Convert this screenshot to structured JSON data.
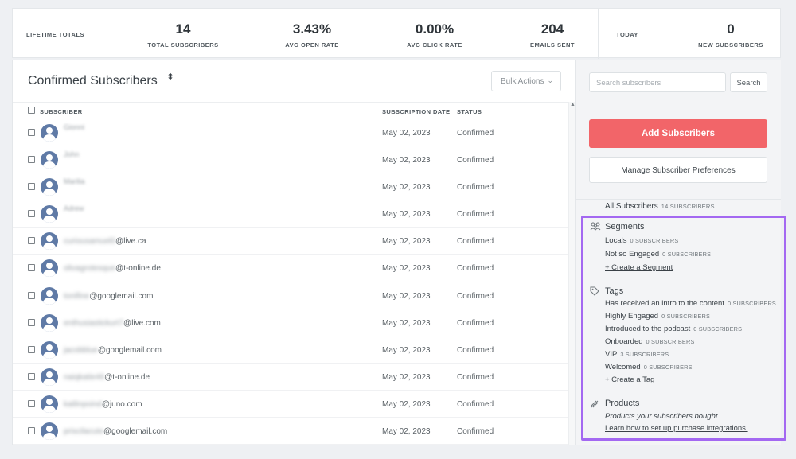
{
  "stats": {
    "lifetime_label": "LIFETIME TOTALS",
    "total_subscribers": {
      "value": "14",
      "label": "TOTAL SUBSCRIBERS"
    },
    "avg_open_rate": {
      "value": "3.43%",
      "label": "AVG OPEN RATE"
    },
    "avg_click_rate": {
      "value": "0.00%",
      "label": "AVG CLICK RATE"
    },
    "emails_sent": {
      "value": "204",
      "label": "EMAILS SENT"
    },
    "today_label": "TODAY",
    "new_subscribers": {
      "value": "0",
      "label": "NEW SUBSCRIBERS"
    }
  },
  "main": {
    "title": "Confirmed Subscribers",
    "title_caret": "⬍",
    "bulk_actions": "Bulk Actions",
    "columns": {
      "subscriber": "SUBSCRIBER",
      "date": "SUBSCRIPTION DATE",
      "status": "STATUS"
    },
    "rows": [
      {
        "name": "Gionni",
        "email_blur": "",
        "email_domain": "",
        "date": "May 02, 2023",
        "status": "Confirmed"
      },
      {
        "name": "John",
        "email_blur": "",
        "email_domain": "",
        "date": "May 02, 2023",
        "status": "Confirmed"
      },
      {
        "name": "Marilia",
        "email_blur": "",
        "email_domain": "",
        "date": "May 02, 2023",
        "status": "Confirmed"
      },
      {
        "name": "Adrew",
        "email_blur": "",
        "email_domain": "",
        "date": "May 02, 2023",
        "status": "Confirmed"
      },
      {
        "name": "",
        "email_blur": "curiousamuel0",
        "email_domain": "@live.ca",
        "date": "May 02, 2023",
        "status": "Confirmed"
      },
      {
        "name": "",
        "email_blur": "olivagrotesque",
        "email_domain": "@t-online.de",
        "date": "May 02, 2023",
        "status": "Confirmed"
      },
      {
        "name": "",
        "email_blur": "tonifine",
        "email_domain": "@googlemail.com",
        "date": "May 02, 2023",
        "status": "Confirmed"
      },
      {
        "name": "",
        "email_blur": "enthusiastickurt7",
        "email_domain": "@live.com",
        "date": "May 02, 2023",
        "status": "Confirmed"
      },
      {
        "name": "",
        "email_blur": "jacobblue",
        "email_domain": "@googlemail.com",
        "date": "May 02, 2023",
        "status": "Confirmed"
      },
      {
        "name": "",
        "email_blur": "naiqkatie46",
        "email_domain": "@t-online.de",
        "date": "May 02, 2023",
        "status": "Confirmed"
      },
      {
        "name": "",
        "email_blur": "katlinpoind",
        "email_domain": "@juno.com",
        "date": "May 02, 2023",
        "status": "Confirmed"
      },
      {
        "name": "",
        "email_blur": "priscilacute",
        "email_domain": "@googlemail.com",
        "date": "May 02, 2023",
        "status": "Confirmed"
      }
    ]
  },
  "side": {
    "search_placeholder": "Search subscribers",
    "search_button": "Search",
    "add_button": "Add Subscribers",
    "pref_button": "Manage Subscriber Preferences",
    "all_subscribers": {
      "label": "All Subscribers",
      "count": "14 SUBSCRIBERS"
    },
    "segments": {
      "title": "Segments",
      "icon": "users-icon",
      "items": [
        {
          "label": "Locals",
          "count": "0 SUBSCRIBERS"
        },
        {
          "label": "Not so Engaged",
          "count": "0 SUBSCRIBERS"
        }
      ],
      "create_link": "+ Create a Segment"
    },
    "tags": {
      "title": "Tags",
      "icon": "tag-icon",
      "items": [
        {
          "label": "Has received an intro to the content",
          "count": "0 SUBSCRIBERS"
        },
        {
          "label": "Highly Engaged",
          "count": "0 SUBSCRIBERS"
        },
        {
          "label": "Introduced to the podcast",
          "count": "0 SUBSCRIBERS"
        },
        {
          "label": "Onboarded",
          "count": "0 SUBSCRIBERS"
        },
        {
          "label": "VIP",
          "count": "3 SUBSCRIBERS"
        },
        {
          "label": "Welcomed",
          "count": "0 SUBSCRIBERS"
        }
      ],
      "create_link": "+ Create a Tag"
    },
    "products": {
      "title": "Products",
      "icon": "product-tag-icon",
      "description": "Products your subscribers bought.",
      "link": "Learn how to set up purchase integrations."
    }
  },
  "colors": {
    "accent": "#f26569",
    "highlight": "#a368f1",
    "avatar": "#5f7aa6"
  }
}
